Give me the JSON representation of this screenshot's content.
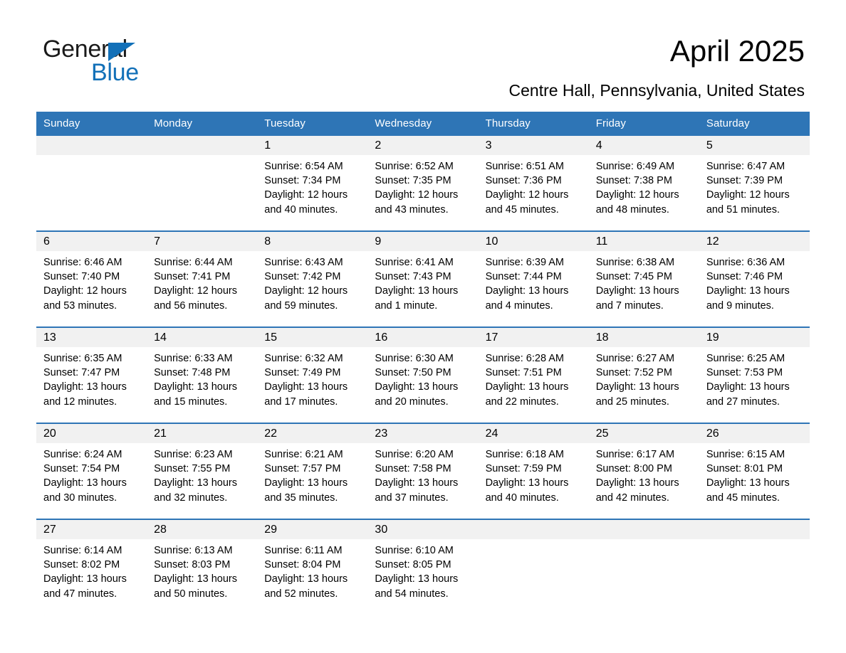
{
  "brand": {
    "name_part1": "General",
    "name_part2": "Blue",
    "triangle_icon": "triangle-icon",
    "color_black": "#1a1a1a",
    "color_blue": "#1270b8"
  },
  "header": {
    "title": "April 2025",
    "subtitle": "Centre Hall, Pennsylvania, United States"
  },
  "theme": {
    "header_blue": "#2e75b6",
    "daynum_band": "#f1f1f1",
    "text": "#000000"
  },
  "weekday_headers": [
    "Sunday",
    "Monday",
    "Tuesday",
    "Wednesday",
    "Thursday",
    "Friday",
    "Saturday"
  ],
  "weeks": [
    [
      {
        "day": "",
        "sunrise": "",
        "sunset": "",
        "daylight": "",
        "empty": true
      },
      {
        "day": "",
        "sunrise": "",
        "sunset": "",
        "daylight": "",
        "empty": true
      },
      {
        "day": "1",
        "sunrise": "Sunrise: 6:54 AM",
        "sunset": "Sunset: 7:34 PM",
        "daylight": "Daylight: 12 hours and 40 minutes."
      },
      {
        "day": "2",
        "sunrise": "Sunrise: 6:52 AM",
        "sunset": "Sunset: 7:35 PM",
        "daylight": "Daylight: 12 hours and 43 minutes."
      },
      {
        "day": "3",
        "sunrise": "Sunrise: 6:51 AM",
        "sunset": "Sunset: 7:36 PM",
        "daylight": "Daylight: 12 hours and 45 minutes."
      },
      {
        "day": "4",
        "sunrise": "Sunrise: 6:49 AM",
        "sunset": "Sunset: 7:38 PM",
        "daylight": "Daylight: 12 hours and 48 minutes."
      },
      {
        "day": "5",
        "sunrise": "Sunrise: 6:47 AM",
        "sunset": "Sunset: 7:39 PM",
        "daylight": "Daylight: 12 hours and 51 minutes."
      }
    ],
    [
      {
        "day": "6",
        "sunrise": "Sunrise: 6:46 AM",
        "sunset": "Sunset: 7:40 PM",
        "daylight": "Daylight: 12 hours and 53 minutes."
      },
      {
        "day": "7",
        "sunrise": "Sunrise: 6:44 AM",
        "sunset": "Sunset: 7:41 PM",
        "daylight": "Daylight: 12 hours and 56 minutes."
      },
      {
        "day": "8",
        "sunrise": "Sunrise: 6:43 AM",
        "sunset": "Sunset: 7:42 PM",
        "daylight": "Daylight: 12 hours and 59 minutes."
      },
      {
        "day": "9",
        "sunrise": "Sunrise: 6:41 AM",
        "sunset": "Sunset: 7:43 PM",
        "daylight": "Daylight: 13 hours and 1 minute."
      },
      {
        "day": "10",
        "sunrise": "Sunrise: 6:39 AM",
        "sunset": "Sunset: 7:44 PM",
        "daylight": "Daylight: 13 hours and 4 minutes."
      },
      {
        "day": "11",
        "sunrise": "Sunrise: 6:38 AM",
        "sunset": "Sunset: 7:45 PM",
        "daylight": "Daylight: 13 hours and 7 minutes."
      },
      {
        "day": "12",
        "sunrise": "Sunrise: 6:36 AM",
        "sunset": "Sunset: 7:46 PM",
        "daylight": "Daylight: 13 hours and 9 minutes."
      }
    ],
    [
      {
        "day": "13",
        "sunrise": "Sunrise: 6:35 AM",
        "sunset": "Sunset: 7:47 PM",
        "daylight": "Daylight: 13 hours and 12 minutes."
      },
      {
        "day": "14",
        "sunrise": "Sunrise: 6:33 AM",
        "sunset": "Sunset: 7:48 PM",
        "daylight": "Daylight: 13 hours and 15 minutes."
      },
      {
        "day": "15",
        "sunrise": "Sunrise: 6:32 AM",
        "sunset": "Sunset: 7:49 PM",
        "daylight": "Daylight: 13 hours and 17 minutes."
      },
      {
        "day": "16",
        "sunrise": "Sunrise: 6:30 AM",
        "sunset": "Sunset: 7:50 PM",
        "daylight": "Daylight: 13 hours and 20 minutes."
      },
      {
        "day": "17",
        "sunrise": "Sunrise: 6:28 AM",
        "sunset": "Sunset: 7:51 PM",
        "daylight": "Daylight: 13 hours and 22 minutes."
      },
      {
        "day": "18",
        "sunrise": "Sunrise: 6:27 AM",
        "sunset": "Sunset: 7:52 PM",
        "daylight": "Daylight: 13 hours and 25 minutes."
      },
      {
        "day": "19",
        "sunrise": "Sunrise: 6:25 AM",
        "sunset": "Sunset: 7:53 PM",
        "daylight": "Daylight: 13 hours and 27 minutes."
      }
    ],
    [
      {
        "day": "20",
        "sunrise": "Sunrise: 6:24 AM",
        "sunset": "Sunset: 7:54 PM",
        "daylight": "Daylight: 13 hours and 30 minutes."
      },
      {
        "day": "21",
        "sunrise": "Sunrise: 6:23 AM",
        "sunset": "Sunset: 7:55 PM",
        "daylight": "Daylight: 13 hours and 32 minutes."
      },
      {
        "day": "22",
        "sunrise": "Sunrise: 6:21 AM",
        "sunset": "Sunset: 7:57 PM",
        "daylight": "Daylight: 13 hours and 35 minutes."
      },
      {
        "day": "23",
        "sunrise": "Sunrise: 6:20 AM",
        "sunset": "Sunset: 7:58 PM",
        "daylight": "Daylight: 13 hours and 37 minutes."
      },
      {
        "day": "24",
        "sunrise": "Sunrise: 6:18 AM",
        "sunset": "Sunset: 7:59 PM",
        "daylight": "Daylight: 13 hours and 40 minutes."
      },
      {
        "day": "25",
        "sunrise": "Sunrise: 6:17 AM",
        "sunset": "Sunset: 8:00 PM",
        "daylight": "Daylight: 13 hours and 42 minutes."
      },
      {
        "day": "26",
        "sunrise": "Sunrise: 6:15 AM",
        "sunset": "Sunset: 8:01 PM",
        "daylight": "Daylight: 13 hours and 45 minutes."
      }
    ],
    [
      {
        "day": "27",
        "sunrise": "Sunrise: 6:14 AM",
        "sunset": "Sunset: 8:02 PM",
        "daylight": "Daylight: 13 hours and 47 minutes."
      },
      {
        "day": "28",
        "sunrise": "Sunrise: 6:13 AM",
        "sunset": "Sunset: 8:03 PM",
        "daylight": "Daylight: 13 hours and 50 minutes."
      },
      {
        "day": "29",
        "sunrise": "Sunrise: 6:11 AM",
        "sunset": "Sunset: 8:04 PM",
        "daylight": "Daylight: 13 hours and 52 minutes."
      },
      {
        "day": "30",
        "sunrise": "Sunrise: 6:10 AM",
        "sunset": "Sunset: 8:05 PM",
        "daylight": "Daylight: 13 hours and 54 minutes."
      },
      {
        "day": "",
        "sunrise": "",
        "sunset": "",
        "daylight": "",
        "empty": true
      },
      {
        "day": "",
        "sunrise": "",
        "sunset": "",
        "daylight": "",
        "empty": true
      },
      {
        "day": "",
        "sunrise": "",
        "sunset": "",
        "daylight": "",
        "empty": true
      }
    ]
  ]
}
